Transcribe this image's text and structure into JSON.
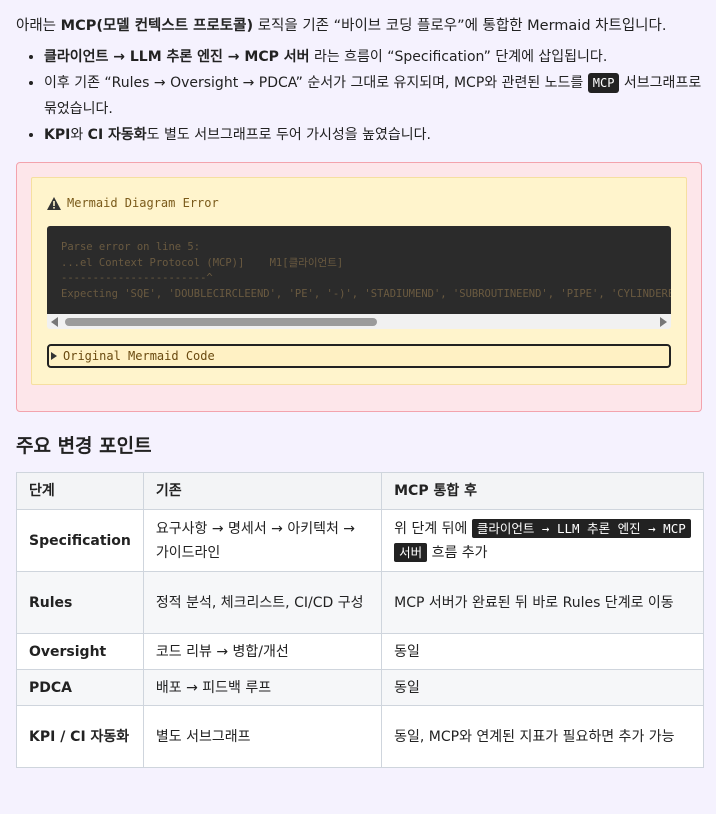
{
  "intro": {
    "pre": "아래는 ",
    "bold": "MCP(모델 컨텍스트 프로토콜)",
    "post": " 로직을 기존 “바이브 코딩 플로우”에 통합한 Mermaid 차트입니다."
  },
  "bullets": [
    {
      "bold": "클라이언트 → LLM 추론 엔진 → MCP 서버",
      "text": " 라는 흐름이 “Specification” 단계에 삽입됩니다."
    },
    {
      "text_pre": "이후 기존 “Rules → Oversight → PDCA” 순서가 그대로 유지되며, MCP와 관련된 노드를 ",
      "chip": "MCP",
      "text_post": " 서브그래프로 묶었습니다."
    },
    {
      "bold1": "KPI",
      "mid": "와 ",
      "bold2": "CI 자동화",
      "text": "도 별도 서브그래프로 두어 가시성을 높였습니다."
    }
  ],
  "error": {
    "title": "Mermaid Diagram Error",
    "lines": [
      "Parse error on line 5:",
      "...el Context Protocol (MCP)]    M1[클라이언트]",
      "-----------------------^",
      "Expecting 'SQE', 'DOUBLECIRCLEEND', 'PE', '-)', 'STADIUMEND', 'SUBROUTINEEND', 'PIPE', 'CYLINDEREND', 'DIAMOND_STOP', 'TAGEND'"
    ],
    "details_label": "Original Mermaid Code"
  },
  "section_title": "주요 변경 포인트",
  "table": {
    "headers": [
      "단계",
      "기존",
      "MCP 통합 후"
    ],
    "rows": [
      {
        "stage": "Specification",
        "before": "요구사항 → 명세서 → 아키텍처 → 가이드라인",
        "after_pre": "위 단계 뒤에 ",
        "after_chip": "클라이언트 → LLM 추론 엔진 → MCP 서버",
        "after_post": " 흐름 추가"
      },
      {
        "stage": "Rules",
        "before": "정적 분석, 체크리스트, CI/CD 구성",
        "after": "MCP 서버가 완료된 뒤 바로 Rules 단계로 이동"
      },
      {
        "stage": "Oversight",
        "before": "코드 리뷰 → 병합/개선",
        "after": "동일"
      },
      {
        "stage": "PDCA",
        "before": "배포 → 피드백 루프",
        "after": "동일"
      },
      {
        "stage": "KPI / CI 자동화",
        "before": "별도 서브그래프",
        "after": "동일, MCP와 연계된 지표가 필요하면 추가 가능"
      }
    ]
  }
}
